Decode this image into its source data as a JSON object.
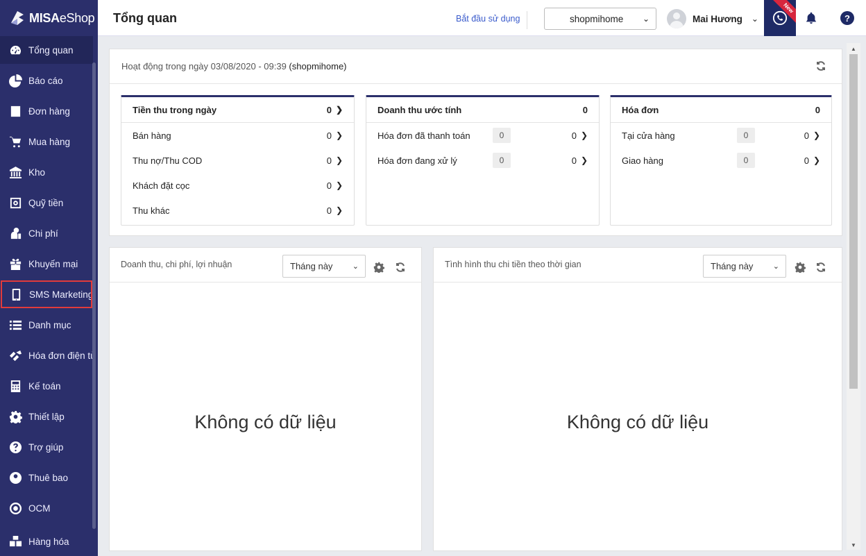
{
  "brand": {
    "name_bold": "MISA",
    "name_thin": "eShop"
  },
  "sidebar": {
    "items": [
      {
        "label": "Tổng quan",
        "icon": "dashboard-icon"
      },
      {
        "label": "Báo cáo",
        "icon": "pie-chart-icon"
      },
      {
        "label": "Đơn hàng",
        "icon": "order-icon"
      },
      {
        "label": "Mua hàng",
        "icon": "cart-icon"
      },
      {
        "label": "Kho",
        "icon": "warehouse-icon"
      },
      {
        "label": "Quỹ tiền",
        "icon": "safe-icon"
      },
      {
        "label": "Chi phí",
        "icon": "expense-icon"
      },
      {
        "label": "Khuyến mại",
        "icon": "gift-icon"
      },
      {
        "label": "SMS Marketing",
        "icon": "phone-icon"
      },
      {
        "label": "Danh mục",
        "icon": "list-icon"
      },
      {
        "label": "Hóa đơn điện tử",
        "icon": "e-invoice-icon"
      },
      {
        "label": "Kế toán",
        "icon": "calculator-icon"
      },
      {
        "label": "Thiết lập",
        "icon": "gear-icon"
      },
      {
        "label": "Trợ giúp",
        "icon": "help-icon"
      },
      {
        "label": "Thuê bao",
        "icon": "user-icon"
      },
      {
        "label": "OCM",
        "icon": "ocm-icon"
      },
      {
        "label": "Hàng hóa",
        "icon": "goods-icon"
      }
    ],
    "active_index": 0,
    "highlight_index": 8
  },
  "header": {
    "title": "Tổng quan",
    "start_link": "Bắt đầu sử dụng",
    "shop": "shopmihome",
    "user_name": "Mai Hương",
    "new_badge": "New",
    "help": "?"
  },
  "activity": {
    "title_prefix": "Hoạt động trong ngày 03/08/2020 - 09:39",
    "title_shop": "(shopmihome)",
    "cards": [
      {
        "title": "Tiền thu trong ngày",
        "total": "0",
        "rows": [
          {
            "label": "Bán hàng",
            "value": "0"
          },
          {
            "label": "Thu nợ/Thu COD",
            "value": "0"
          },
          {
            "label": "Khách đặt cọc",
            "value": "0"
          },
          {
            "label": "Thu khác",
            "value": "0"
          }
        ]
      },
      {
        "title": "Doanh thu ước tính",
        "total": "0",
        "rows": [
          {
            "label": "Hóa đơn đã thanh toán",
            "count": "0",
            "value": "0"
          },
          {
            "label": "Hóa đơn đang xử lý",
            "count": "0",
            "value": "0"
          }
        ]
      },
      {
        "title": "Hóa đơn",
        "total": "0",
        "rows": [
          {
            "label": "Tại cửa hàng",
            "count": "0",
            "value": "0"
          },
          {
            "label": "Giao hàng",
            "count": "0",
            "value": "0"
          }
        ]
      }
    ]
  },
  "panels": [
    {
      "title": "Doanh thu, chi phí, lợi nhuận",
      "period": "Tháng này",
      "empty": "Không có dữ liệu"
    },
    {
      "title": "Tình hình thu chi tiền theo thời gian",
      "period": "Tháng này",
      "empty": "Không có dữ liệu"
    }
  ],
  "colors": {
    "sidebar": "#2b2f6b",
    "accent": "#1e2a66",
    "highlight_border": "#e23b3b",
    "new_ribbon": "#d7263d"
  }
}
